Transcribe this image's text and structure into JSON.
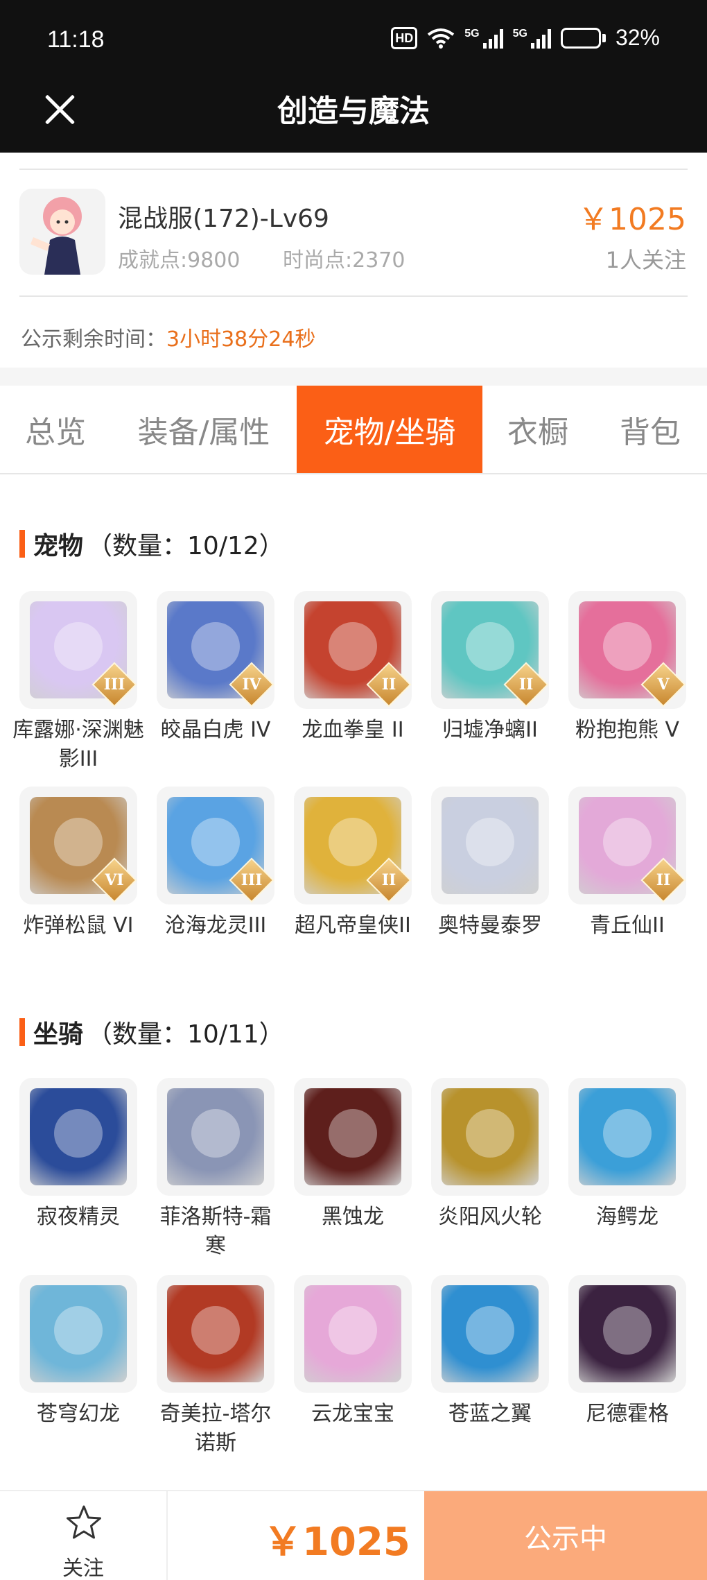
{
  "status_bar": {
    "time": "11:18",
    "hd_label": "HD",
    "signal1_tag": "5G",
    "signal2_tag": "5G",
    "battery_percent": "32%",
    "battery_level": 0.32
  },
  "header": {
    "title": "创造与魔法",
    "close_icon": "close-icon"
  },
  "account": {
    "server_name": "混战服(172)-Lv69",
    "achievement": "成就点:9800",
    "fashion": "时尚点:2370",
    "price": "￥1025",
    "followers": "1人关注",
    "notice_label": "公示剩余时间：",
    "notice_time": "3小时38分24秒"
  },
  "tabs": [
    {
      "label": "总览",
      "active": false
    },
    {
      "label": "装备/属性",
      "active": false
    },
    {
      "label": "宠物/坐骑",
      "active": true
    },
    {
      "label": "衣橱",
      "active": false
    },
    {
      "label": "背包",
      "active": false
    }
  ],
  "pets": {
    "title": "宠物",
    "count": "（数量：10/12）",
    "items": [
      {
        "name": "库露娜·深渊魅影III",
        "rank": "III",
        "color": "#d9c7f2"
      },
      {
        "name": "皎晶白虎 IV",
        "rank": "IV",
        "color": "#5a79c9"
      },
      {
        "name": "龙血拳皇 II",
        "rank": "II",
        "color": "#c5432f"
      },
      {
        "name": "归墟净螭II",
        "rank": "II",
        "color": "#5fc6c2"
      },
      {
        "name": "粉抱抱熊 V",
        "rank": "V",
        "color": "#e56f9b"
      },
      {
        "name": "炸弹松鼠 VI",
        "rank": "VI",
        "color": "#b98a52"
      },
      {
        "name": "沧海龙灵III",
        "rank": "III",
        "color": "#5aa3e3"
      },
      {
        "name": "超凡帝皇侠II",
        "rank": "II",
        "color": "#e0b23b"
      },
      {
        "name": "奥特曼泰罗",
        "rank": "",
        "color": "#c9cfe0"
      },
      {
        "name": "青丘仙II",
        "rank": "II",
        "color": "#e3a9d8"
      }
    ]
  },
  "mounts": {
    "title": "坐骑",
    "count": "（数量：10/11）",
    "items": [
      {
        "name": "寂夜精灵",
        "color": "#2b4c9a"
      },
      {
        "name": "菲洛斯特-霜寒",
        "color": "#8a95b5"
      },
      {
        "name": "黑蚀龙",
        "color": "#5e1f1c"
      },
      {
        "name": "炎阳风火轮",
        "color": "#b8922c"
      },
      {
        "name": "海鳄龙",
        "color": "#3b9fd8"
      },
      {
        "name": "苍穹幻龙",
        "color": "#6fb6d9"
      },
      {
        "name": "奇美拉-塔尔诺斯",
        "color": "#b23a24"
      },
      {
        "name": "云龙宝宝",
        "color": "#e6a8d8"
      },
      {
        "name": "苍蓝之翼",
        "color": "#2f8fd1"
      },
      {
        "name": "尼德霍格",
        "color": "#3b2240"
      }
    ]
  },
  "bottom": {
    "follow_label": "关注",
    "price": "￥1025",
    "status_label": "公示中"
  }
}
